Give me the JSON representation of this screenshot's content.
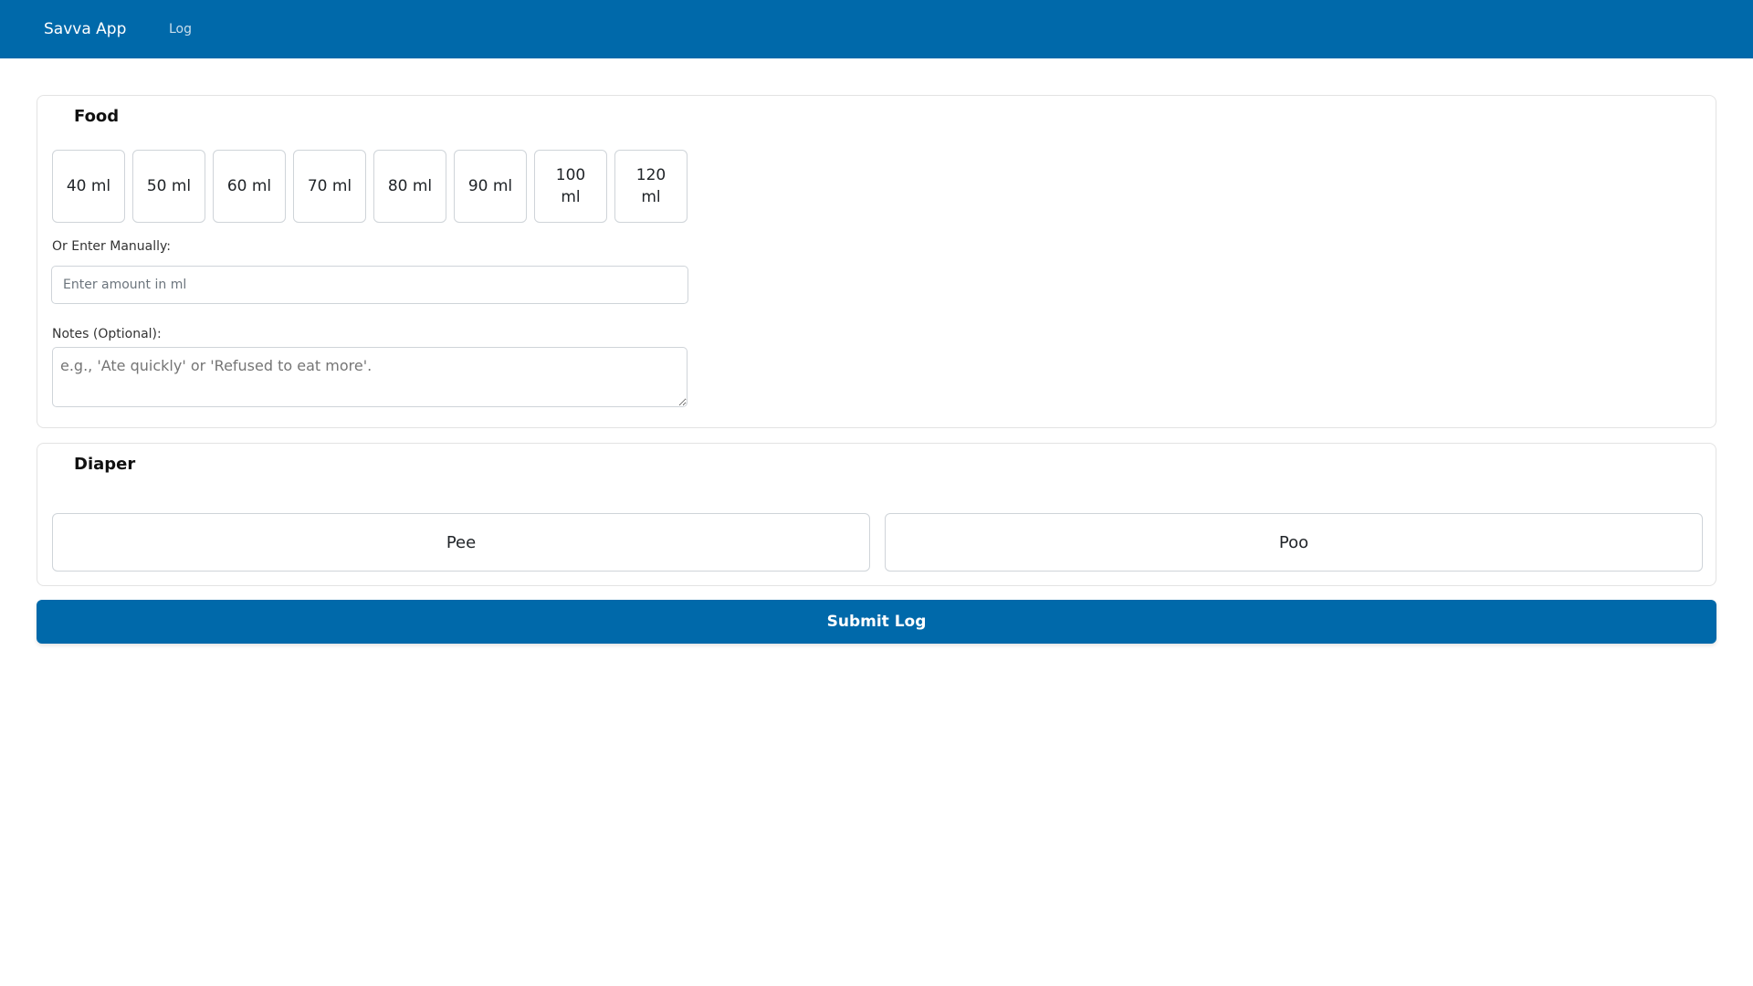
{
  "navbar": {
    "brand": "Savva App",
    "links": [
      {
        "label": "Log"
      }
    ]
  },
  "food": {
    "title": "Food",
    "amounts": [
      {
        "label": "40 ml"
      },
      {
        "label": "50 ml"
      },
      {
        "label": "60 ml"
      },
      {
        "label": "70 ml"
      },
      {
        "label": "80 ml"
      },
      {
        "label": "90 ml"
      },
      {
        "label": "100 ml"
      },
      {
        "label": "120 ml"
      }
    ],
    "manual_label": "Or Enter Manually:",
    "manual_placeholder": "Enter amount in ml",
    "manual_value": "",
    "notes_label": "Notes (Optional):",
    "notes_placeholder": "e.g., 'Ate quickly' or 'Refused to eat more'.",
    "notes_value": ""
  },
  "diaper": {
    "title": "Diaper",
    "pee_label": "Pee",
    "poo_label": "Poo"
  },
  "submit_label": "Submit Log",
  "colors": {
    "primary": "#0069aa",
    "border": "#cfd4d9",
    "card_border": "#e3e3e3"
  }
}
